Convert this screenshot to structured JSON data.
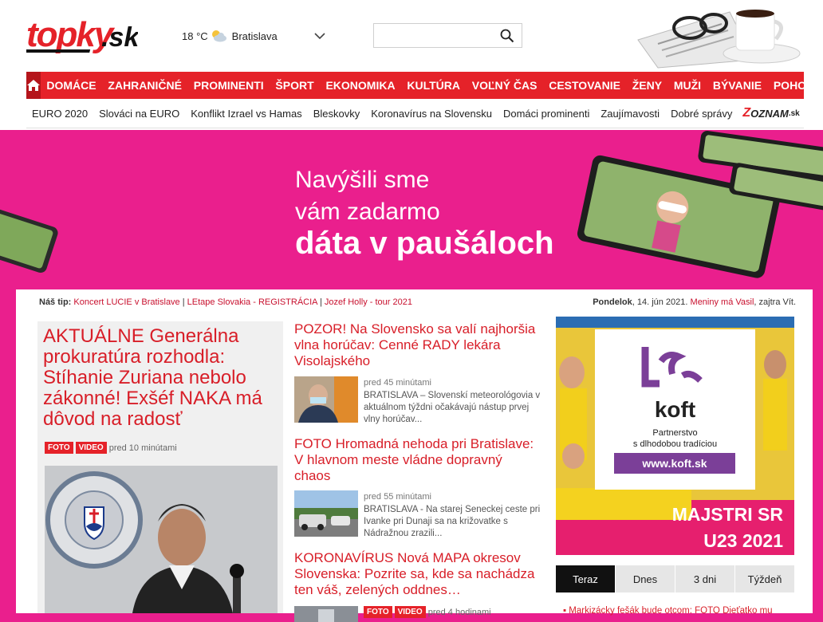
{
  "header": {
    "logo": "topky.sk",
    "weather": {
      "temperature": "18 °C",
      "city": "Bratislava"
    },
    "search": {
      "placeholder": ""
    }
  },
  "main_nav": [
    "DOMÁCE",
    "ZAHRANIČNÉ",
    "PROMINENTI",
    "ŠPORT",
    "EKONOMIKA",
    "KULTÚRA",
    "VOĽNÝ ČAS",
    "CESTOVANIE",
    "ŽENY",
    "MUŽI",
    "BÝVANIE",
    "POHODO"
  ],
  "sub_nav": [
    "EURO 2020",
    "Slováci na EURO",
    "Konflikt Izrael vs Hamas",
    "Bleskovky",
    "Koronavírus na Slovensku",
    "Domáci prominenti",
    "Zaujímavosti",
    "Dobré správy"
  ],
  "zoznam": {
    "z": "Z",
    "rest": "OZNAM",
    "suffix": ".sk"
  },
  "banner": {
    "line1": "Navýšili sme",
    "line2": "vám zadarmo",
    "line3": "dáta v paušáloch"
  },
  "tip": {
    "label": "Náš tip:",
    "links": [
      "Koncert LUCIE v Bratislave",
      "LEtape Slovakia - REGISTRÁCIA",
      "Jozef Holly - tour 2021"
    ],
    "sep": " | "
  },
  "date": {
    "day": "Pondelok",
    "date": ", 14. jún 2021.",
    "name_day": "Meniny má Vasil",
    "tomorrow": ", zajtra Vít."
  },
  "lead": {
    "title": "AKTUÁLNE Generálna prokuratúra rozhodla: Stíhanie Zuriana nebolo zákonné! Exšéf NAKA má dôvod na radosť",
    "tags": [
      "FOTO",
      "VIDEO"
    ],
    "time": "pred 10 minútami"
  },
  "articles": [
    {
      "title": "POZOR! Na Slovensko sa valí najhoršia vlna horúčav: Cenné RADY lekára Visolajského",
      "time": "pred 45 minútami",
      "snippet": "BRATISLAVA – Slovenskí meteorológovia v aktuálnom týždni očakávajú nástup prvej vlny horúčav..."
    },
    {
      "title": "FOTO Hromadná nehoda pri Bratislave: V hlavnom meste vládne dopravný chaos",
      "time": "pred 55 minútami",
      "snippet": "BRATISLAVA - Na starej Seneckej ceste pri Ivanke pri Dunaji sa na križovatke s Nádražnou zrazili..."
    },
    {
      "title": "KORONAVÍRUS Nová MAPA okresov Slovenska: Pozrite sa, kde sa nachádza ten váš, zelených oddnes…",
      "tags": [
        "FOTO",
        "VIDEO"
      ],
      "time": "pred 4 hodinami"
    }
  ],
  "ad": {
    "brand": "koft",
    "tagline1": "Partnerstvo",
    "tagline2": "s dlhodobou tradíciou",
    "url": "www.koft.sk",
    "promo1": "MAJSTRI SR",
    "promo2": "U23 2021"
  },
  "tabs": [
    "Teraz",
    "Dnes",
    "3 dni",
    "Týždeň"
  ],
  "trending": [
    "Markizácky fešák bude otcom: FOTO Dieťatko mu"
  ],
  "colors": {
    "brand_red": "#e52229",
    "banner_pink": "#ea1f8d",
    "headline_red": "#d81e28",
    "ad_purple": "#7b3f98"
  }
}
